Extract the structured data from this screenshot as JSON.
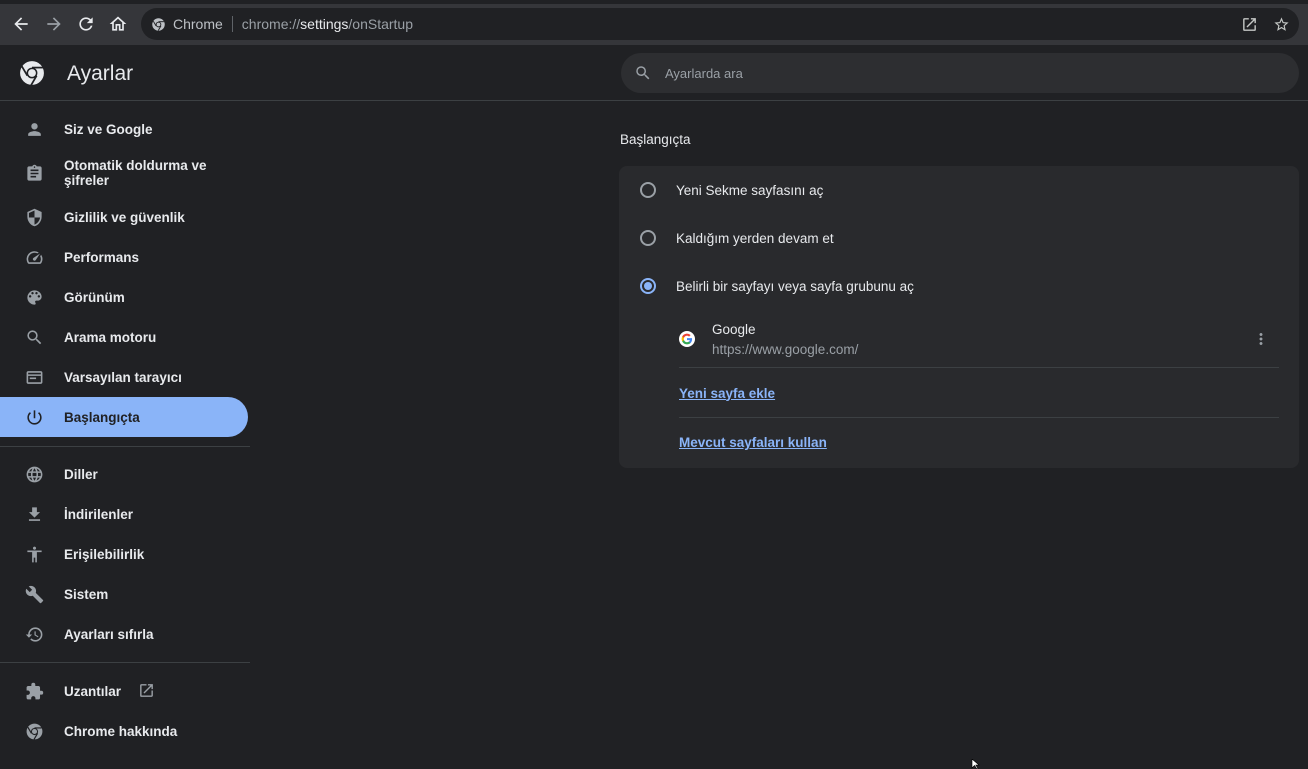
{
  "browser": {
    "back_icon": "arrow-back-icon",
    "forward_icon": "arrow-forward-icon",
    "reload_icon": "reload-icon",
    "home_icon": "home-icon",
    "omnibox": {
      "chip_label": "Chrome",
      "url_scheme": "chrome://",
      "url_host": "settings",
      "url_path": "/onStartup"
    }
  },
  "header": {
    "title": "Ayarlar",
    "search_placeholder": "Ayarlarda ara"
  },
  "sidebar": {
    "items": [
      {
        "label": "Siz ve Google",
        "icon": "person-icon"
      },
      {
        "label": "Otomatik doldurma ve şifreler",
        "icon": "clipboard-icon"
      },
      {
        "label": "Gizlilik ve güvenlik",
        "icon": "shield-icon"
      },
      {
        "label": "Performans",
        "icon": "speedometer-icon"
      },
      {
        "label": "Görünüm",
        "icon": "palette-icon"
      },
      {
        "label": "Arama motoru",
        "icon": "search-icon"
      },
      {
        "label": "Varsayılan tarayıcı",
        "icon": "browser-window-icon"
      },
      {
        "label": "Başlangıçta",
        "icon": "power-icon",
        "active": true
      },
      {
        "label": "Diller",
        "icon": "globe-icon"
      },
      {
        "label": "İndirilenler",
        "icon": "download-icon"
      },
      {
        "label": "Erişilebilirlik",
        "icon": "accessibility-icon"
      },
      {
        "label": "Sistem",
        "icon": "wrench-icon"
      },
      {
        "label": "Ayarları sıfırla",
        "icon": "history-icon"
      },
      {
        "label": "Uzantılar",
        "icon": "puzzle-icon"
      },
      {
        "label": "Chrome hakkında",
        "icon": "chrome-icon"
      }
    ]
  },
  "main": {
    "section_title": "Başlangıçta",
    "options": [
      {
        "label": "Yeni Sekme sayfasını aç",
        "checked": false
      },
      {
        "label": "Kaldığım yerden devam et",
        "checked": false
      },
      {
        "label": "Belirli bir sayfayı veya sayfa grubunu aç",
        "checked": true
      }
    ],
    "startup_page": {
      "name": "Google",
      "url": "https://www.google.com/"
    },
    "add_page_link": "Yeni sayfa ekle",
    "use_current_link": "Mevcut sayfaları kullan"
  },
  "colors": {
    "accent": "#8ab4f8",
    "background": "#202124",
    "card": "#292a2d"
  }
}
